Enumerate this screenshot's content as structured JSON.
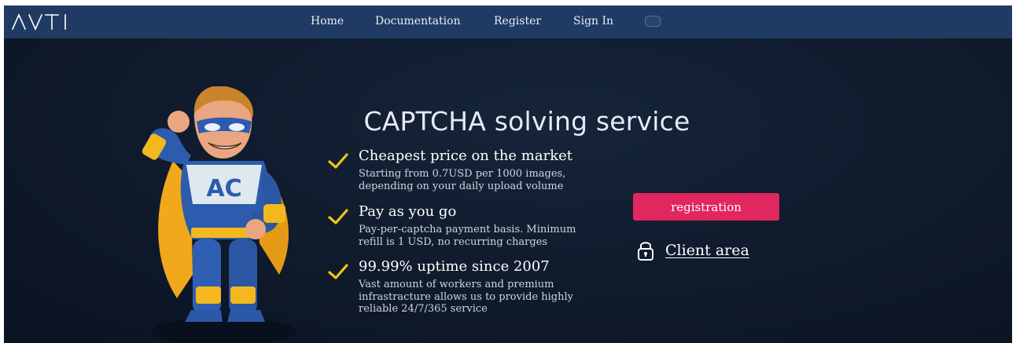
{
  "navbar": {
    "logo_alt": "AATI",
    "links": [
      {
        "label": "Home"
      },
      {
        "label": "Documentation"
      },
      {
        "label": "Register"
      },
      {
        "label": "Sign In"
      }
    ]
  },
  "hero": {
    "headline": "CAPTCHA solving service",
    "mascot_badge": "AC",
    "features": [
      {
        "title": "Cheapest price on the market",
        "description": "Starting from 0.7USD per 1000 images, depending on your daily upload volume"
      },
      {
        "title": "Pay as you go",
        "description": "Pay-per-captcha payment basis. Minimum refill is 1 USD, no recurring charges"
      },
      {
        "title": "99.99% uptime since 2007",
        "description": "Vast amount of workers and premium infrastracture allows us to provide highly reliable 24/7/365 service"
      }
    ],
    "registration_button": "registration",
    "client_area_link": "Client area"
  },
  "colors": {
    "navbar": "#1f3a63",
    "background": "#0f1a2b",
    "accent": "#e2265f",
    "check": "#f2c318"
  },
  "icons": {
    "feature_bullet": "checkmark-icon",
    "client_area": "lock-icon",
    "language": "language-toggle-icon"
  }
}
